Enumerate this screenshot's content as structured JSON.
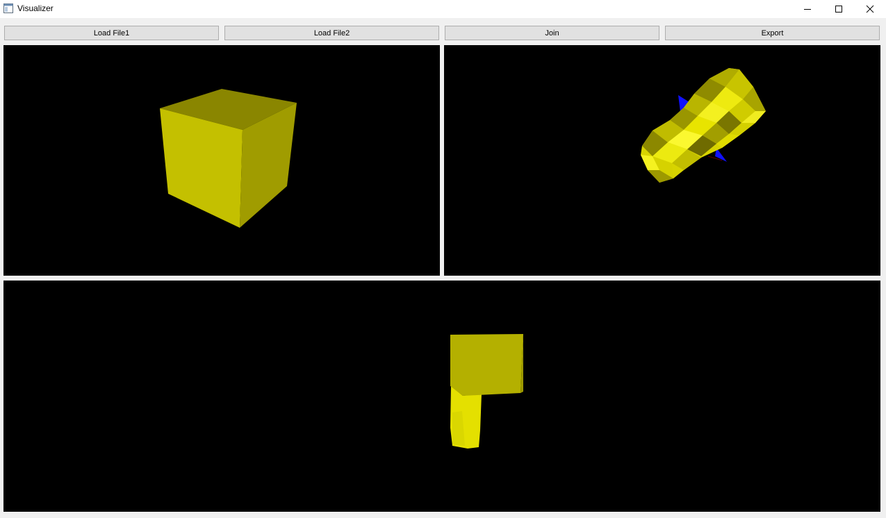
{
  "window": {
    "title": "Visualizer",
    "icon": "app-window-icon",
    "controls": [
      "minimize-icon",
      "maximize-icon",
      "close-icon"
    ]
  },
  "toolbar": {
    "load_file1_label": "Load File1",
    "load_file2_label": "Load File2",
    "join_label": "Join",
    "export_label": "Export"
  },
  "viewports": {
    "file1": {
      "background": "#000000",
      "object": "yellow cube",
      "color": "#c8c400"
    },
    "file2": {
      "background": "#000000",
      "object": "yellow faceted cylinder mesh",
      "color": "#e6e600",
      "axis_colors": [
        "#0000ff",
        "#ff0000"
      ]
    },
    "joined": {
      "background": "#000000",
      "object": "joined cube and cylinder",
      "color": "#b3b300"
    }
  }
}
